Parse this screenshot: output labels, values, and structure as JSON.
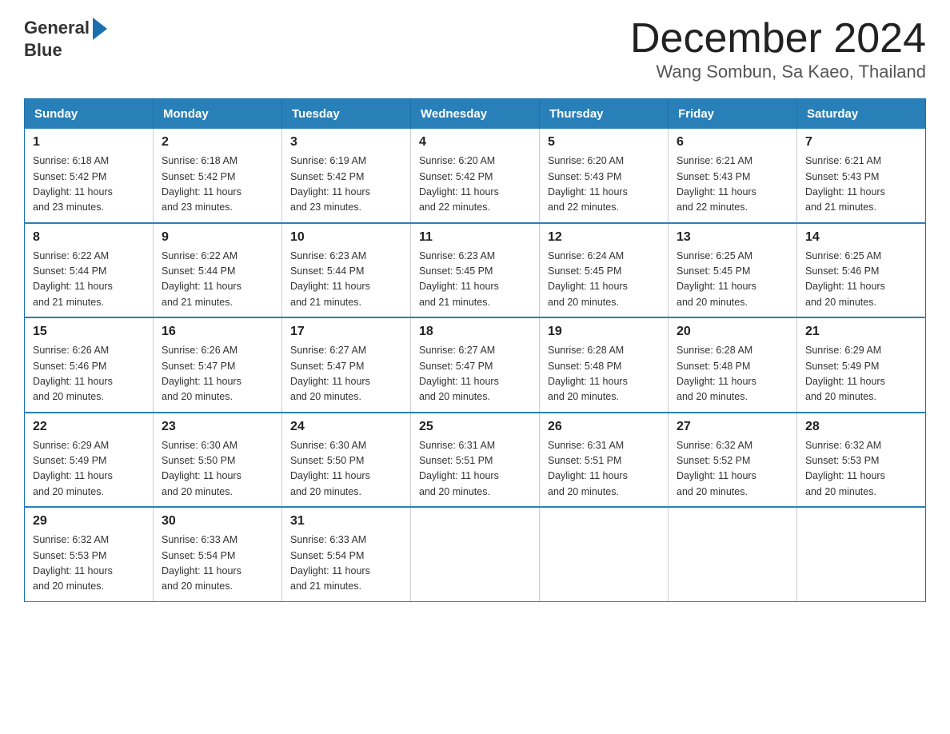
{
  "header": {
    "logo": {
      "general": "General",
      "blue": "Blue"
    },
    "title": "December 2024",
    "subtitle": "Wang Sombun, Sa Kaeo, Thailand"
  },
  "days_of_week": [
    "Sunday",
    "Monday",
    "Tuesday",
    "Wednesday",
    "Thursday",
    "Friday",
    "Saturday"
  ],
  "weeks": [
    [
      {
        "day": "1",
        "sunrise": "6:18 AM",
        "sunset": "5:42 PM",
        "daylight": "11 hours and 23 minutes."
      },
      {
        "day": "2",
        "sunrise": "6:18 AM",
        "sunset": "5:42 PM",
        "daylight": "11 hours and 23 minutes."
      },
      {
        "day": "3",
        "sunrise": "6:19 AM",
        "sunset": "5:42 PM",
        "daylight": "11 hours and 23 minutes."
      },
      {
        "day": "4",
        "sunrise": "6:20 AM",
        "sunset": "5:42 PM",
        "daylight": "11 hours and 22 minutes."
      },
      {
        "day": "5",
        "sunrise": "6:20 AM",
        "sunset": "5:43 PM",
        "daylight": "11 hours and 22 minutes."
      },
      {
        "day": "6",
        "sunrise": "6:21 AM",
        "sunset": "5:43 PM",
        "daylight": "11 hours and 22 minutes."
      },
      {
        "day": "7",
        "sunrise": "6:21 AM",
        "sunset": "5:43 PM",
        "daylight": "11 hours and 21 minutes."
      }
    ],
    [
      {
        "day": "8",
        "sunrise": "6:22 AM",
        "sunset": "5:44 PM",
        "daylight": "11 hours and 21 minutes."
      },
      {
        "day": "9",
        "sunrise": "6:22 AM",
        "sunset": "5:44 PM",
        "daylight": "11 hours and 21 minutes."
      },
      {
        "day": "10",
        "sunrise": "6:23 AM",
        "sunset": "5:44 PM",
        "daylight": "11 hours and 21 minutes."
      },
      {
        "day": "11",
        "sunrise": "6:23 AM",
        "sunset": "5:45 PM",
        "daylight": "11 hours and 21 minutes."
      },
      {
        "day": "12",
        "sunrise": "6:24 AM",
        "sunset": "5:45 PM",
        "daylight": "11 hours and 20 minutes."
      },
      {
        "day": "13",
        "sunrise": "6:25 AM",
        "sunset": "5:45 PM",
        "daylight": "11 hours and 20 minutes."
      },
      {
        "day": "14",
        "sunrise": "6:25 AM",
        "sunset": "5:46 PM",
        "daylight": "11 hours and 20 minutes."
      }
    ],
    [
      {
        "day": "15",
        "sunrise": "6:26 AM",
        "sunset": "5:46 PM",
        "daylight": "11 hours and 20 minutes."
      },
      {
        "day": "16",
        "sunrise": "6:26 AM",
        "sunset": "5:47 PM",
        "daylight": "11 hours and 20 minutes."
      },
      {
        "day": "17",
        "sunrise": "6:27 AM",
        "sunset": "5:47 PM",
        "daylight": "11 hours and 20 minutes."
      },
      {
        "day": "18",
        "sunrise": "6:27 AM",
        "sunset": "5:47 PM",
        "daylight": "11 hours and 20 minutes."
      },
      {
        "day": "19",
        "sunrise": "6:28 AM",
        "sunset": "5:48 PM",
        "daylight": "11 hours and 20 minutes."
      },
      {
        "day": "20",
        "sunrise": "6:28 AM",
        "sunset": "5:48 PM",
        "daylight": "11 hours and 20 minutes."
      },
      {
        "day": "21",
        "sunrise": "6:29 AM",
        "sunset": "5:49 PM",
        "daylight": "11 hours and 20 minutes."
      }
    ],
    [
      {
        "day": "22",
        "sunrise": "6:29 AM",
        "sunset": "5:49 PM",
        "daylight": "11 hours and 20 minutes."
      },
      {
        "day": "23",
        "sunrise": "6:30 AM",
        "sunset": "5:50 PM",
        "daylight": "11 hours and 20 minutes."
      },
      {
        "day": "24",
        "sunrise": "6:30 AM",
        "sunset": "5:50 PM",
        "daylight": "11 hours and 20 minutes."
      },
      {
        "day": "25",
        "sunrise": "6:31 AM",
        "sunset": "5:51 PM",
        "daylight": "11 hours and 20 minutes."
      },
      {
        "day": "26",
        "sunrise": "6:31 AM",
        "sunset": "5:51 PM",
        "daylight": "11 hours and 20 minutes."
      },
      {
        "day": "27",
        "sunrise": "6:32 AM",
        "sunset": "5:52 PM",
        "daylight": "11 hours and 20 minutes."
      },
      {
        "day": "28",
        "sunrise": "6:32 AM",
        "sunset": "5:53 PM",
        "daylight": "11 hours and 20 minutes."
      }
    ],
    [
      {
        "day": "29",
        "sunrise": "6:32 AM",
        "sunset": "5:53 PM",
        "daylight": "11 hours and 20 minutes."
      },
      {
        "day": "30",
        "sunrise": "6:33 AM",
        "sunset": "5:54 PM",
        "daylight": "11 hours and 20 minutes."
      },
      {
        "day": "31",
        "sunrise": "6:33 AM",
        "sunset": "5:54 PM",
        "daylight": "11 hours and 21 minutes."
      },
      null,
      null,
      null,
      null
    ]
  ],
  "labels": {
    "sunrise": "Sunrise:",
    "sunset": "Sunset:",
    "daylight": "Daylight:"
  }
}
